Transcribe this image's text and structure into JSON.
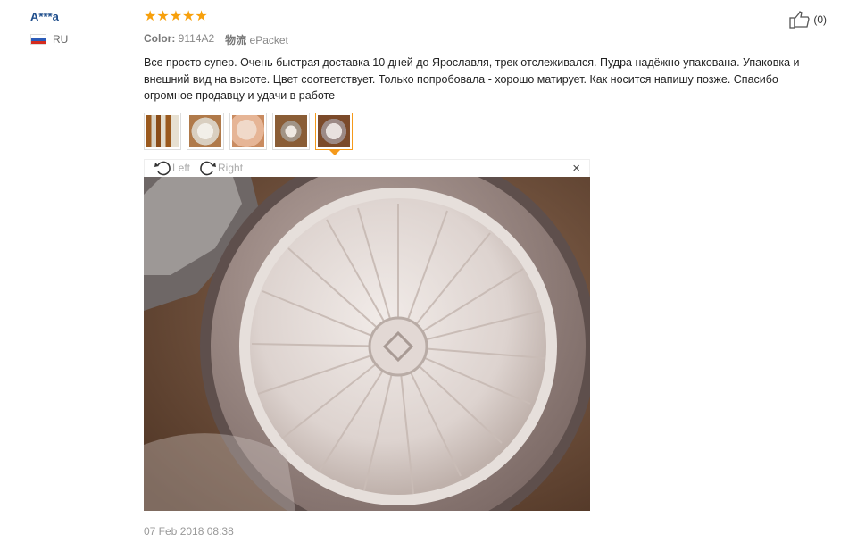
{
  "user": {
    "name": "A***a",
    "country": "RU"
  },
  "review": {
    "stars": 5,
    "color_label": "Color:",
    "color_value": "9114A2",
    "shipping_label": "物流",
    "shipping_value": "ePacket",
    "text": "Все просто супер. Очень быстрая доставка 10 дней до Ярославля, трек отслеживался. Пудра надёжно упакована. Упаковка и внешний вид на высоте. Цвет соответствует. Только попробовала - хорошо матирует. Как носится напишу позже. Спасибо огромное продавцу и удачи в работе",
    "date": "07 Feb 2018 08:38"
  },
  "viewer": {
    "rotate_left": "Left",
    "rotate_right": "Right",
    "close": "×"
  },
  "like": {
    "count": "(0)"
  },
  "colors": {
    "star": "#f7a00c",
    "username": "#1f4e8c",
    "active_thumb_border": "#f59a1b"
  }
}
